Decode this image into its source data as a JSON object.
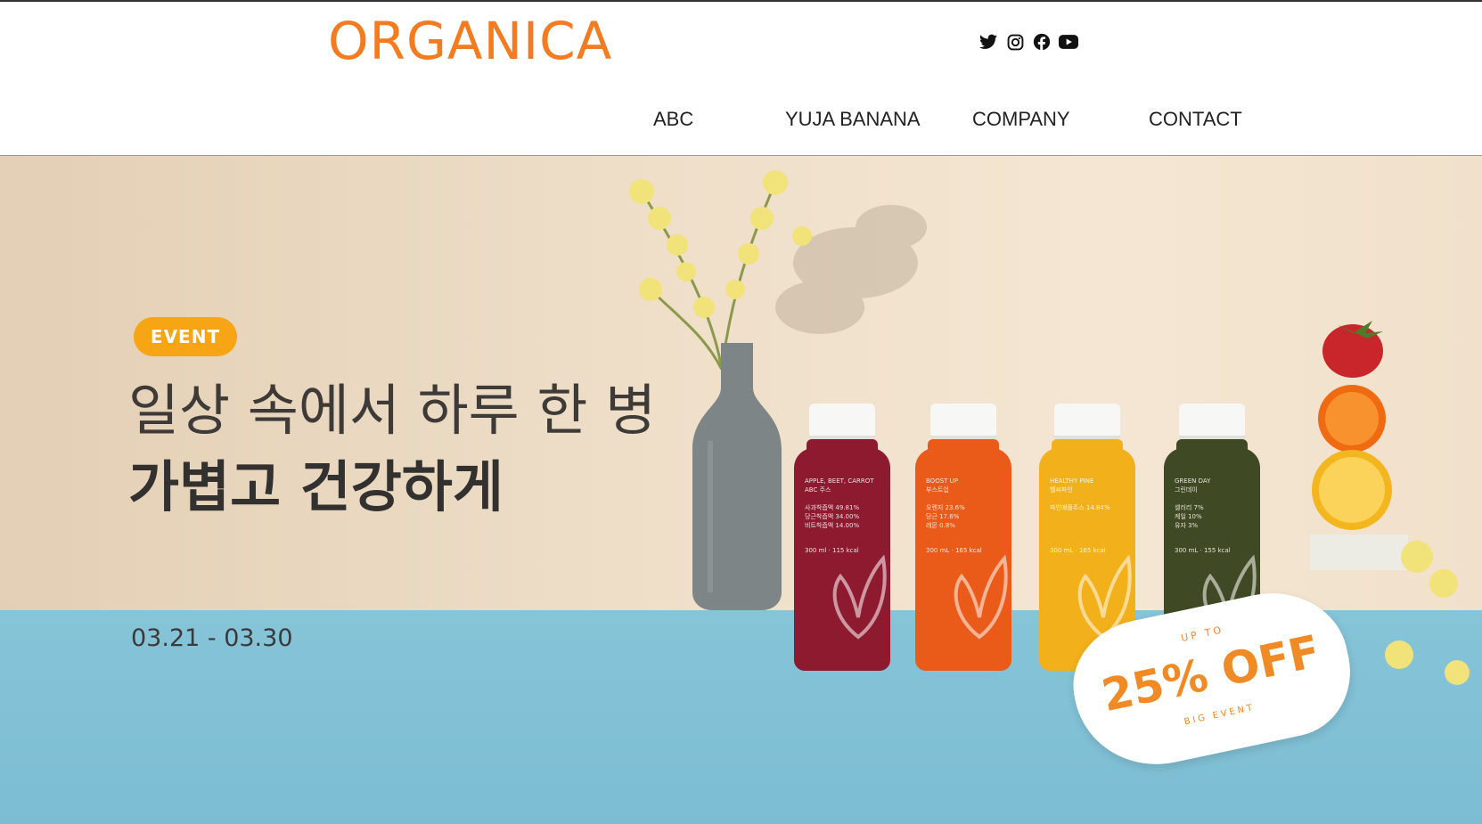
{
  "brand": {
    "logo": "ORGANICA",
    "color": "#f47b20"
  },
  "social": [
    "twitter-icon",
    "instagram-icon",
    "facebook-icon",
    "youtube-icon"
  ],
  "nav": {
    "items": [
      "ABC",
      "YUJA BANANA",
      "COMPANY",
      "CONTACT"
    ]
  },
  "hero": {
    "badge": "EVENT",
    "headline_line1": "일상 속에서 하루 한 병",
    "headline_line2": "가볍고 건강하게",
    "dates": "03.21 - 03.30",
    "badge_color": "#f7a515",
    "sticker": {
      "top": "UP TO",
      "main": "25% OFF",
      "bottom": "BIG EVENT"
    }
  },
  "bottles": [
    {
      "name": "APPLE, BEET, CARROT",
      "sub": "ABC 주스",
      "lines": [
        "사과착즙액 49.81%",
        "당근착즙액 34.00%",
        "비트착즙액 14.00%"
      ],
      "kcal": "300 ml · 115 kcal",
      "color": "#8e1a30"
    },
    {
      "name": "BOOST UP",
      "sub": "부스트업",
      "lines": [
        "오렌지 23.6%",
        "당근 17.6%",
        "레몬 0.8%"
      ],
      "kcal": "300 mL · 165 kcal",
      "color": "#ea5a18"
    },
    {
      "name": "HEALTHY PINE",
      "sub": "헬씨파인",
      "lines": [
        "파인애플주스 14.84%"
      ],
      "kcal": "300 mL · 165 kcal",
      "color": "#f2b01a"
    },
    {
      "name": "GREEN DAY",
      "sub": "그린데이",
      "lines": [
        "셀러리 7%",
        "케일 10%",
        "유자 3%"
      ],
      "kcal": "300 mL · 155 kcal",
      "color": "#3f4a24"
    }
  ]
}
